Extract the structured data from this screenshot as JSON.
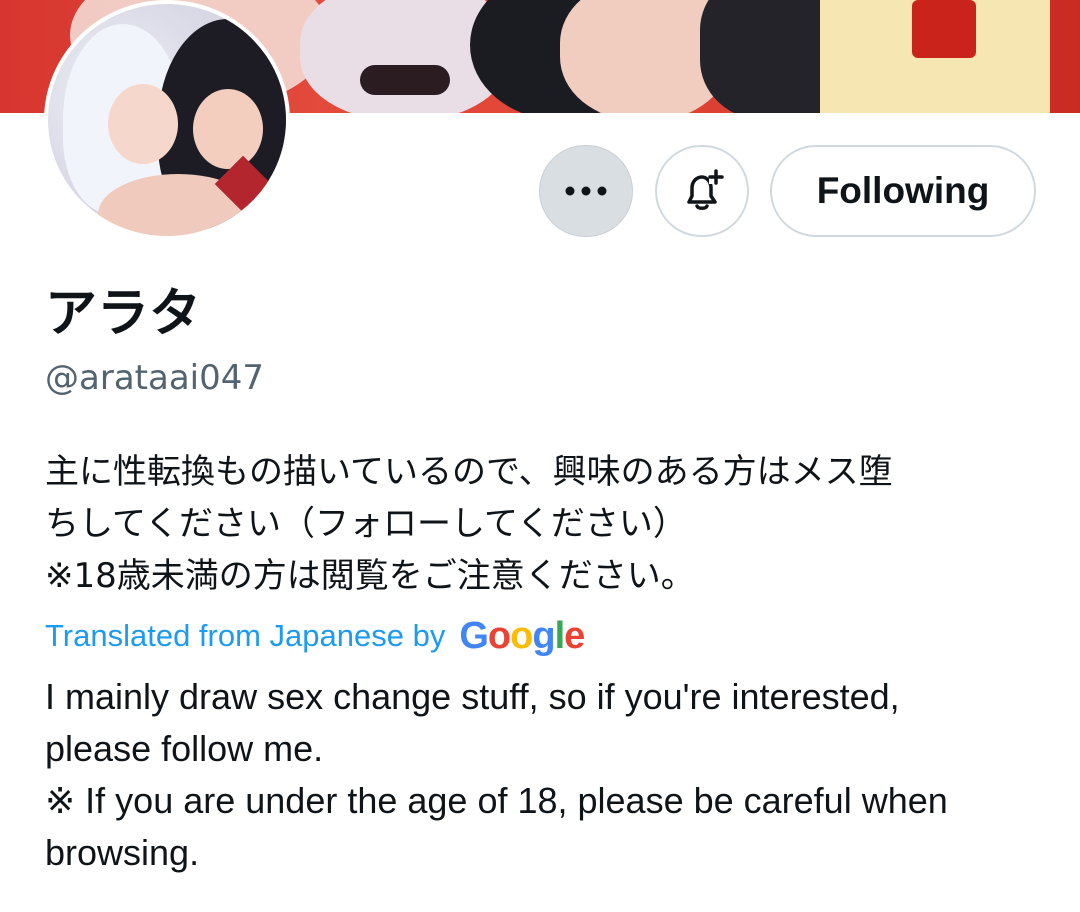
{
  "profile": {
    "display_name": "アラタ",
    "handle": "@arataai047",
    "bio_lines": [
      "主に性転換もの描いているので、興味のある方はメス堕",
      "ちしてください（フォローしてください）",
      "※18歳未満の方は閲覧をご注意ください。"
    ],
    "translated_by_label": "Translated from Japanese by",
    "google_letters": [
      "G",
      "o",
      "o",
      "g",
      "l",
      "e"
    ],
    "translation_lines": [
      "I mainly draw sex change stuff, so if you're interested,",
      "please follow me.",
      "※ If you are under the age of 18, please be careful when",
      "browsing."
    ]
  },
  "actions": {
    "more_icon": "more-horizontal-icon",
    "notify_icon": "bell-plus-icon",
    "following_label": "Following"
  },
  "colors": {
    "link": "#1d9bf0",
    "secondary_text": "#536471",
    "primary_text": "#0f1419",
    "google": [
      "#4285F4",
      "#EA4335",
      "#FBBC05",
      "#4285F4",
      "#34A853",
      "#EA4335"
    ]
  }
}
